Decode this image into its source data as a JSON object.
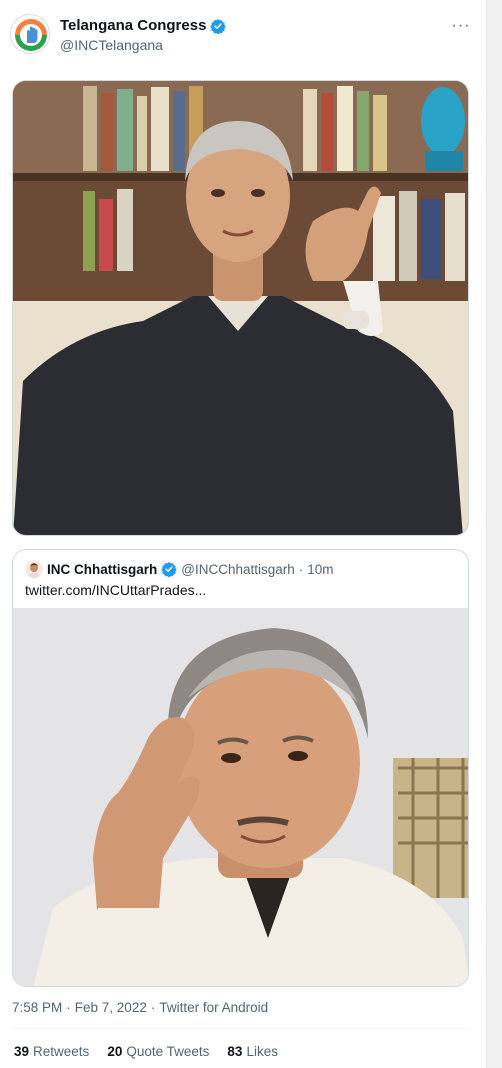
{
  "author": {
    "display_name": "Telangana Congress",
    "handle": "@INCTelangana",
    "avatar_icon": "congress-hand-logo-icon",
    "verified_icon": "verified-badge-icon"
  },
  "more_icon": "more-options-icon",
  "more_glyph": "···",
  "quoted": {
    "display_name": "INC Chhattisgarh",
    "handle": "@INCChhattisgarh",
    "separator": "·",
    "time": "10m",
    "text": "twitter.com/INCUttarPrades..."
  },
  "meta": {
    "time": "7:58 PM",
    "date": "Feb 7, 2022",
    "source": "Twitter for Android",
    "separator": "·"
  },
  "stats": {
    "retweets_count": "39",
    "retweets_label": "Retweets",
    "quotes_count": "20",
    "quotes_label": "Quote Tweets",
    "likes_count": "83",
    "likes_label": "Likes"
  },
  "colors": {
    "verified": "#1d9bf0",
    "congress_orange": "#f3813d",
    "congress_green": "#2aa14a",
    "border": "#cfd9de"
  }
}
